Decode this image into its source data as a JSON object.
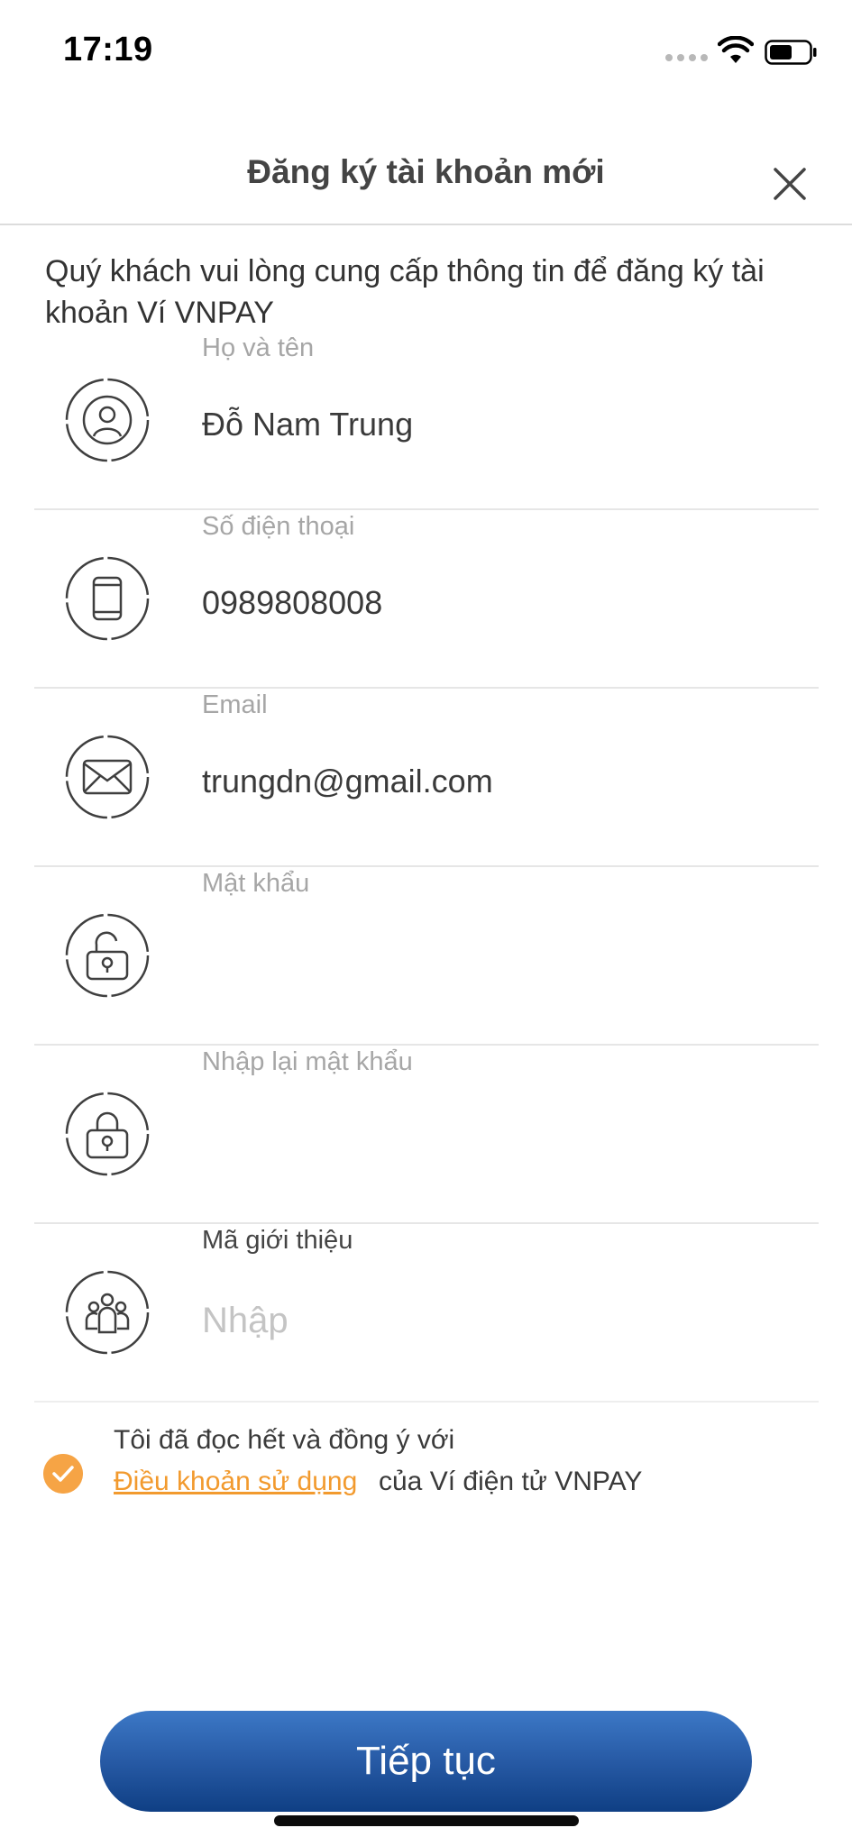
{
  "status_bar": {
    "time": "17:19"
  },
  "header": {
    "title": "Đăng ký tài khoản mới"
  },
  "intro": "Quý khách vui lòng cung cấp thông tin để đăng ký tài khoản Ví VNPAY",
  "fields": [
    {
      "label": "Họ và tên",
      "value": "Đỗ Nam Trung",
      "icon": "user-icon"
    },
    {
      "label": "Số điện thoại",
      "value": "0989808008",
      "icon": "phone-icon"
    },
    {
      "label": "Email",
      "value": "trungdn@gmail.com",
      "icon": "mail-icon"
    },
    {
      "label": "Mật khẩu",
      "value": "",
      "icon": "unlock-icon"
    },
    {
      "label": "Nhập lại mật khẩu",
      "value": "",
      "icon": "lock-icon"
    },
    {
      "label": "Mã giới thiệu",
      "value": "",
      "placeholder": "Nhập",
      "icon": "group-icon"
    }
  ],
  "agreement": {
    "checked": true,
    "line1": "Tôi đã đọc hết và đồng ý với",
    "link": "Điều khoản sử dụng",
    "suffix": "của Ví điện tử VNPAY"
  },
  "continue_button": "Tiếp tục",
  "colors": {
    "accent": "#f6a445",
    "link": "#f29a2e",
    "button_top": "#3c78c6",
    "button_bottom": "#0f3f84"
  }
}
